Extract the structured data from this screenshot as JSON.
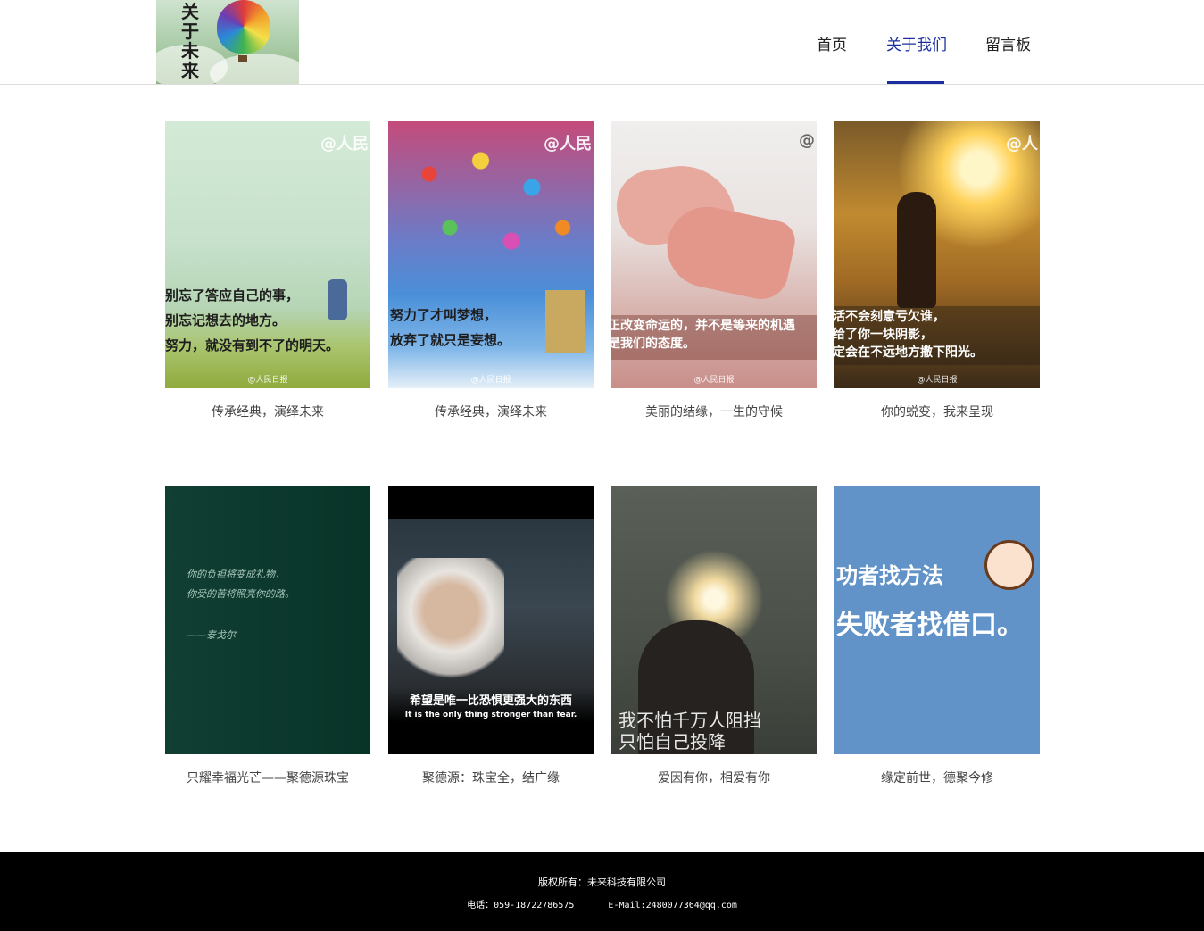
{
  "header": {
    "logo_text": "关于未来",
    "nav": [
      {
        "label": "首页"
      },
      {
        "label": "关于我们",
        "active": true
      },
      {
        "label": "留言板"
      }
    ]
  },
  "gallery": {
    "row1": [
      {
        "caption": "传承经典，演绎未来",
        "overlay": [
          "别忘了答应自己的事，",
          "别忘记想去的地方。",
          "努力，就没有到不了的明天。"
        ],
        "mark": "@人民日报"
      },
      {
        "caption": "传承经典，演绎未来",
        "overlay": [
          "努力了才叫梦想，",
          "放弃了就只是妄想。"
        ],
        "mark": "@人民日报"
      },
      {
        "caption": "美丽的结缘，一生的守候",
        "overlay": [
          "正改变命运的，并不是等来的机遇",
          "是我们的态度。"
        ],
        "mark": "@人民日报"
      },
      {
        "caption": "你的蜕变，我来呈现",
        "overlay": [
          "活不会刻意亏欠谁，",
          "给了你一块阴影，",
          "定会在不远地方撒下阳光。"
        ],
        "mark": "@人民日报"
      }
    ],
    "row2": [
      {
        "caption": "只耀幸福光芒——聚德源珠宝",
        "overlay": [
          "你的负担将变成礼物，",
          "你受的苦将照亮你的路。",
          "——泰戈尔"
        ]
      },
      {
        "caption": "聚德源：珠宝全，结广缘",
        "overlay": [
          "希望是唯一比恐惧更强大的东西",
          "It is the only thing stronger than fear."
        ]
      },
      {
        "caption": "爱因有你，相爱有你",
        "overlay": [
          "我不怕千万人阻挡",
          "只怕自己投降"
        ]
      },
      {
        "caption": "缘定前世，德聚今修",
        "overlay": [
          "功者找方法",
          "失败者找借口。"
        ]
      }
    ]
  },
  "footer": {
    "copyright": "版权所有：未来科技有限公司",
    "phone": "电话：059-18722786575",
    "email": "E-Mail:2480077364@qq.com"
  }
}
